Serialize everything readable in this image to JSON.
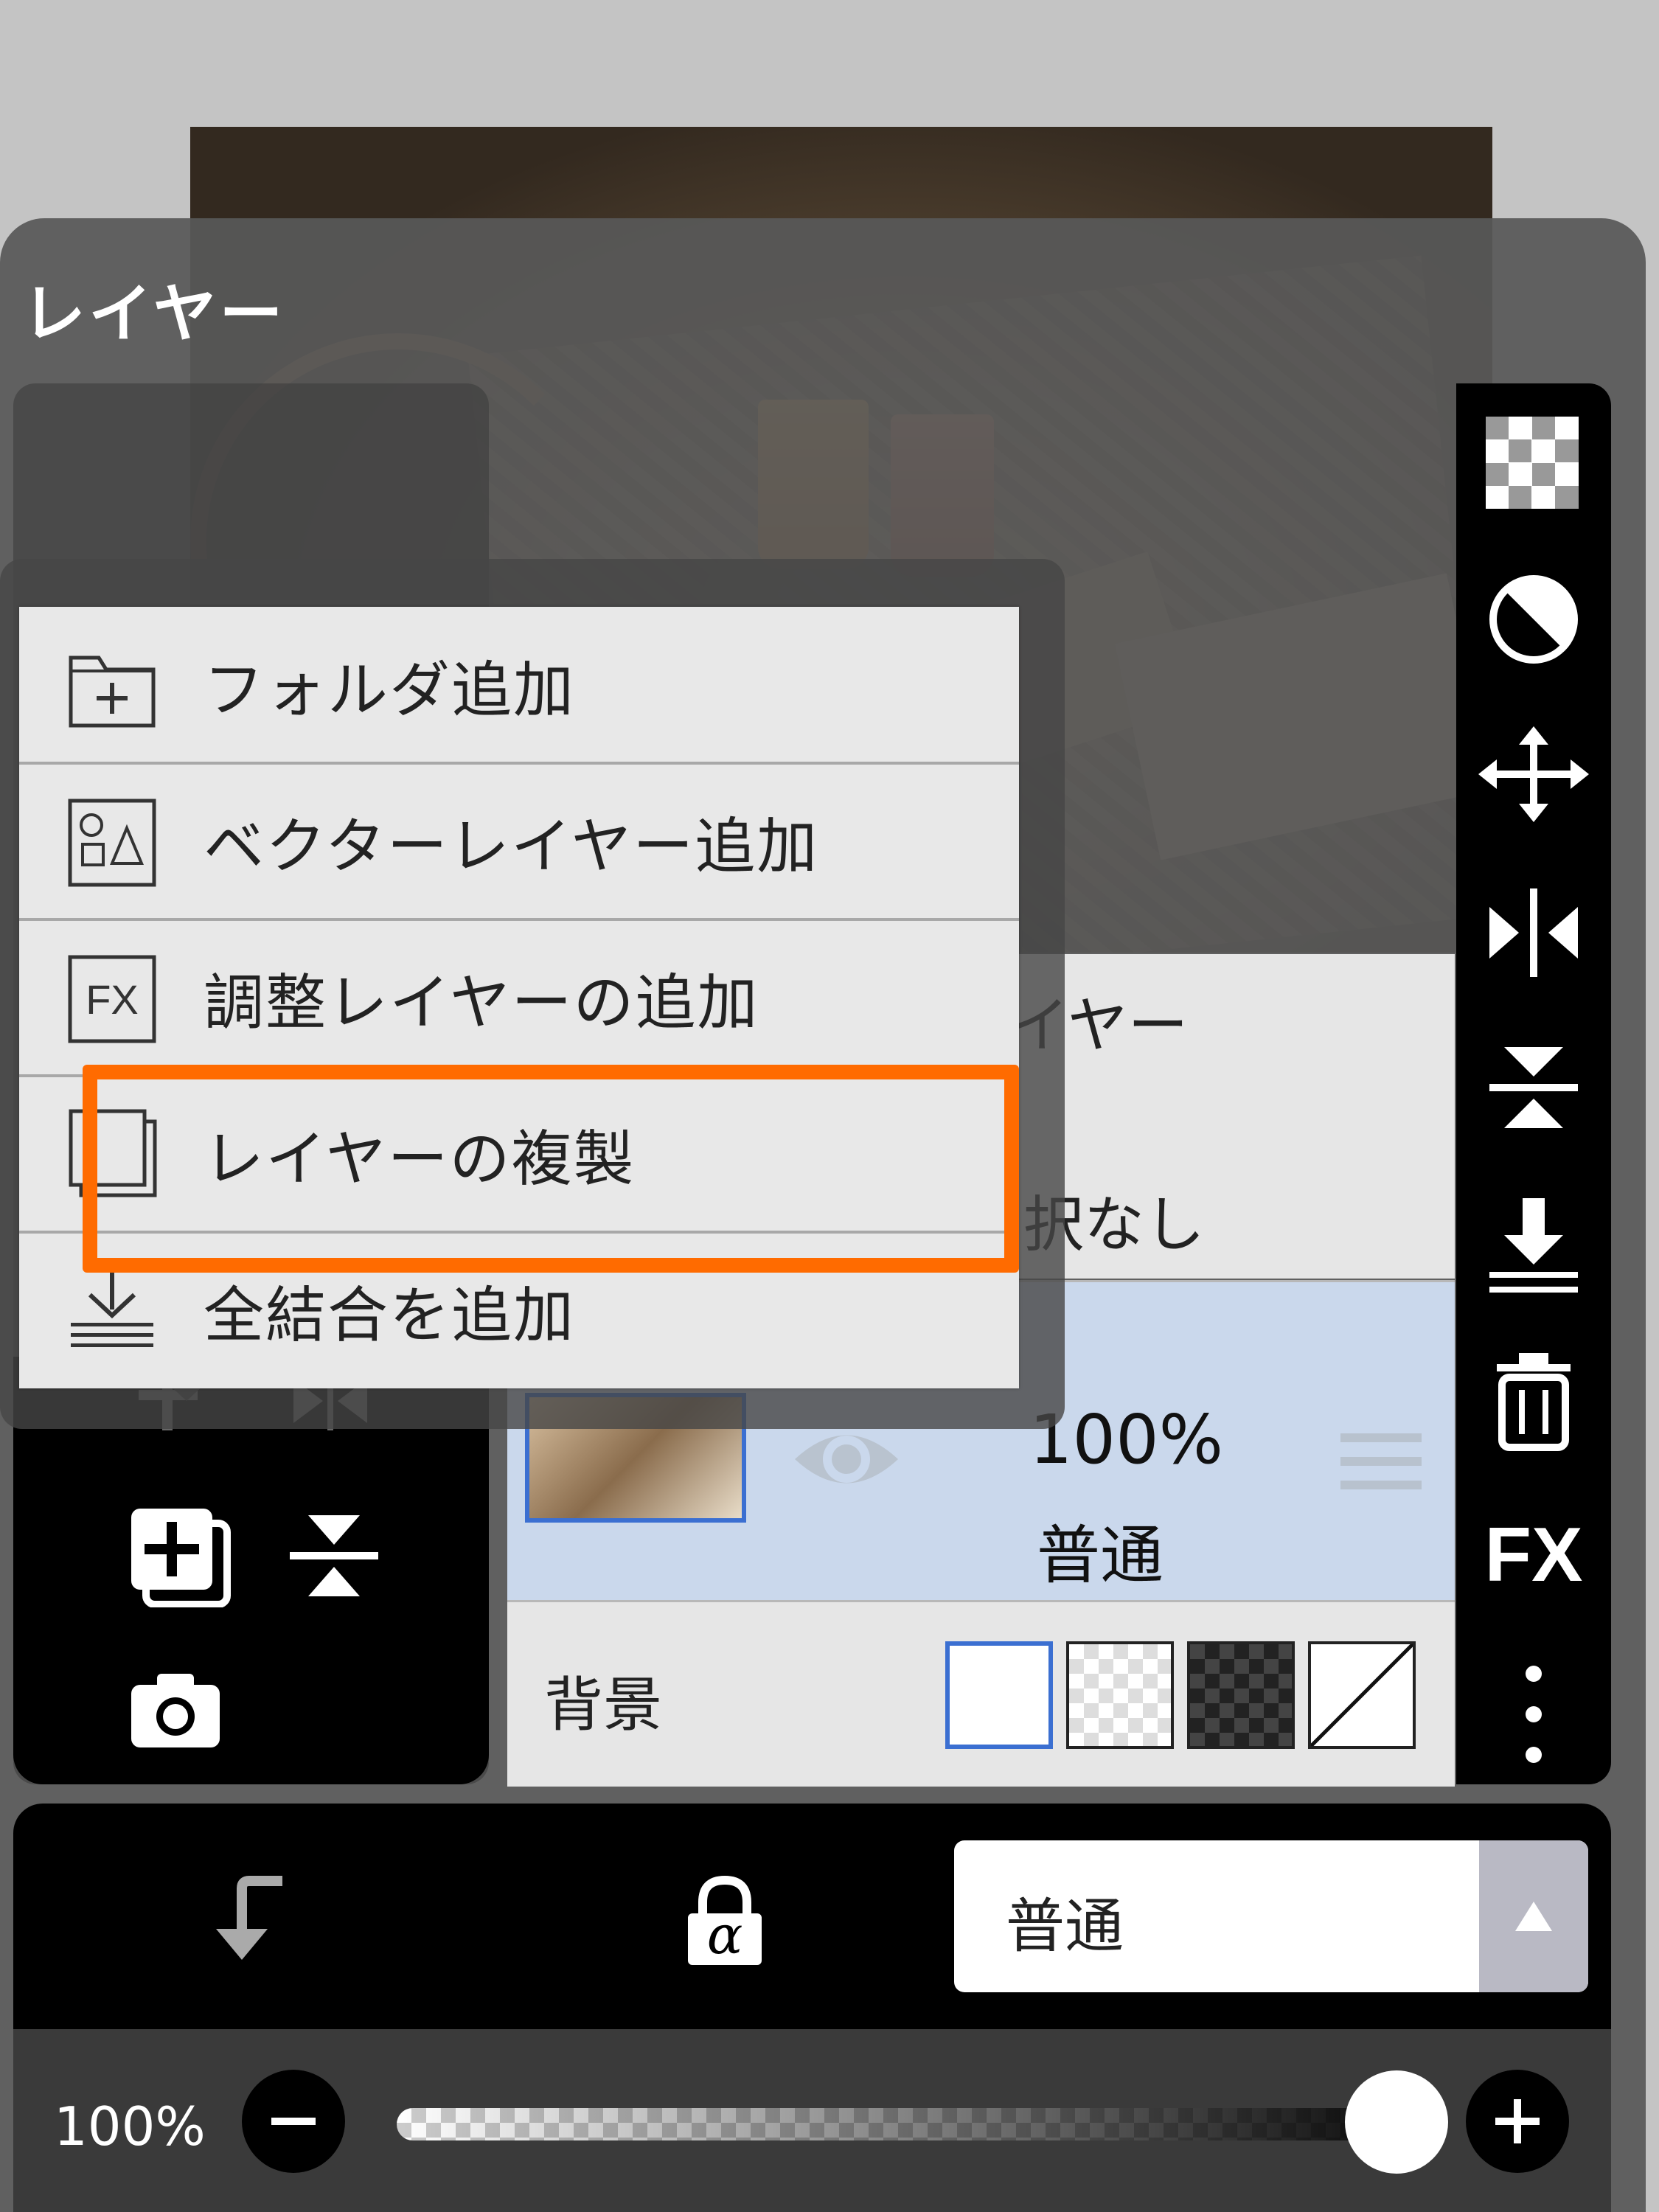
{
  "panel": {
    "title": "レイヤー"
  },
  "menu": {
    "items": [
      {
        "label": "フォルダ追加",
        "icon": "folder-add-icon"
      },
      {
        "label": "ベクターレイヤー追加",
        "icon": "vector-layer-icon"
      },
      {
        "label": "調整レイヤーの追加",
        "icon": "fx-adjustment-icon"
      },
      {
        "label": "レイヤーの複製",
        "icon": "duplicate-layer-icon",
        "highlighted": true
      },
      {
        "label": "全結合を追加",
        "icon": "merge-all-icon"
      }
    ],
    "highlight_color": "#ff6b00"
  },
  "layers": {
    "partial_name": "イヤー",
    "partial_selection": "択なし",
    "selected": {
      "opacity": "100%",
      "blend": "普通"
    },
    "background_label": "背景"
  },
  "right_toolbar": {
    "fx_label": "FX"
  },
  "bottom": {
    "blend_mode": "普通",
    "alpha_lock_label": "α"
  },
  "opacity_slider": {
    "label": "100%",
    "value": 1.0
  }
}
